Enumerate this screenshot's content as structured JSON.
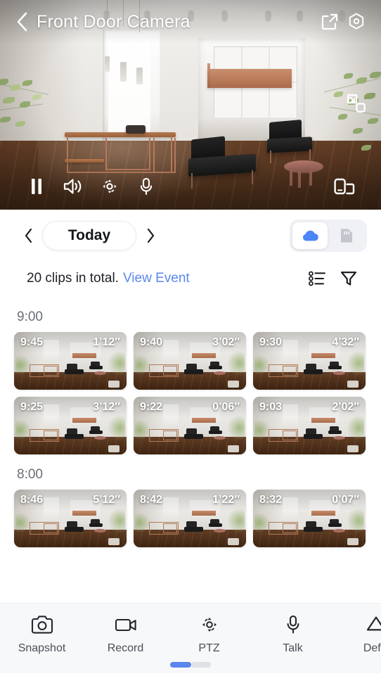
{
  "header": {
    "title": "Front Door Camera",
    "back_icon": "chevron-left-icon",
    "share_icon": "share-external-icon",
    "settings_icon": "hexagon-settings-icon"
  },
  "video": {
    "pip_icon": "picture-in-picture-icon",
    "controls": [
      {
        "name": "pause",
        "icon": "pause-icon"
      },
      {
        "name": "volume",
        "icon": "speaker-on-icon"
      },
      {
        "name": "ptz",
        "icon": "ptz-icon"
      },
      {
        "name": "microphone",
        "icon": "microphone-icon"
      }
    ],
    "fullscreen_icon": "rotate-fullscreen-icon"
  },
  "date_nav": {
    "prev_icon": "chevron-left-icon",
    "label": "Today",
    "next_icon": "chevron-right-icon"
  },
  "storage_toggle": {
    "options": [
      {
        "name": "cloud",
        "icon": "cloud-icon",
        "selected": true
      },
      {
        "name": "sd-card",
        "icon": "sd-card-icon",
        "selected": false
      }
    ],
    "active_color": "#4a86f7",
    "inactive_color": "#c3c6cc"
  },
  "summary": {
    "count_text": "20 clips in total.",
    "link_text": "View Event",
    "link_color": "#5b87ec",
    "list_icon": "list-view-icon",
    "filter_icon": "filter-funnel-icon"
  },
  "groups": [
    {
      "hour": "9:00",
      "rows": [
        [
          {
            "time": "9:45",
            "duration": "1’12″"
          },
          {
            "time": "9:40",
            "duration": "3’02″"
          },
          {
            "time": "9:30",
            "duration": "4’32″"
          }
        ],
        [
          {
            "time": "9:25",
            "duration": "3’12″"
          },
          {
            "time": "9:22",
            "duration": "0’06″"
          },
          {
            "time": "9:03",
            "duration": "2’02″"
          }
        ]
      ]
    },
    {
      "hour": "8:00",
      "rows": [
        [
          {
            "time": "8:46",
            "duration": "5’12″"
          },
          {
            "time": "8:42",
            "duration": "1’22″"
          },
          {
            "time": "8:32",
            "duration": "0’07″"
          }
        ]
      ]
    }
  ],
  "toolbar": {
    "items": [
      {
        "label": "Snapshot",
        "icon": "camera-icon"
      },
      {
        "label": "Record",
        "icon": "video-camera-icon"
      },
      {
        "label": "PTZ",
        "icon": "ptz-icon"
      },
      {
        "label": "Talk",
        "icon": "microphone-icon"
      },
      {
        "label": "Defin",
        "icon": "definition-icon"
      }
    ],
    "page_indicator": {
      "active": 1,
      "total": 2,
      "active_color": "#5b87ec"
    }
  }
}
